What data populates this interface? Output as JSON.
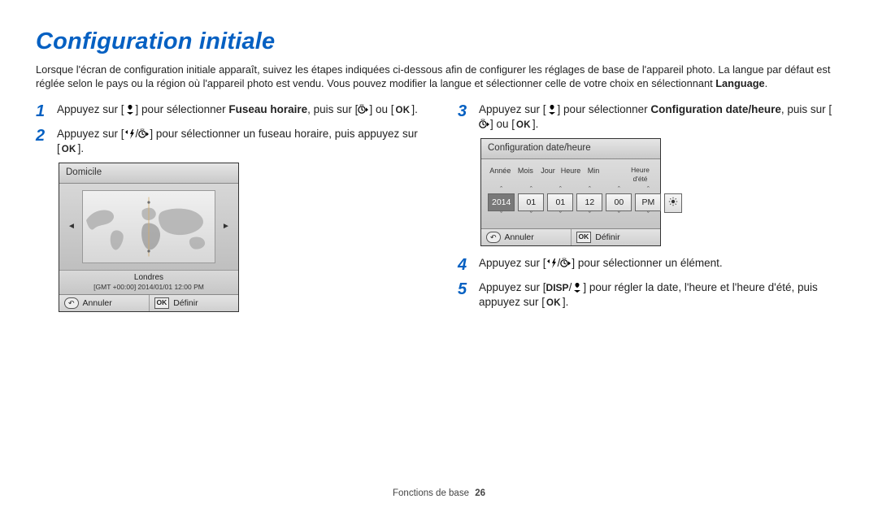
{
  "title": "Configuration initiale",
  "intro": {
    "part1": "Lorsque l'écran de configuration initiale apparaît, suivez les étapes indiquées ci-dessous afin de configurer les réglages de base de l'appareil photo. La langue par défaut est réglée selon le pays ou la région où l'appareil photo est vendu. Vous pouvez modifier la langue et sélectionner celle de votre choix en sélectionnant ",
    "lang_word": "Language",
    "part2": "."
  },
  "ok_label": "OK",
  "step1": {
    "num": "1",
    "pre": "Appuyez sur [",
    "mid1": "] pour sélectionner ",
    "bold": "Fuseau horaire",
    "mid2": ", puis sur [",
    "or": "] ou [",
    "end": "]."
  },
  "step2": {
    "num": "2",
    "pre": "Appuyez sur [",
    "slash": "/",
    "mid": "] pour sélectionner un fuseau horaire, puis appuyez sur [",
    "end": "]."
  },
  "step3": {
    "num": "3",
    "pre": "Appuyez sur [",
    "mid1": "] pour sélectionner ",
    "bold": "Configuration date/heure",
    "mid2": ", puis sur [",
    "or": "] ou [",
    "end": "]."
  },
  "step4": {
    "num": "4",
    "pre": "Appuyez sur [",
    "slash": "/",
    "mid": "] pour sélectionner un élément."
  },
  "step5": {
    "num": "5",
    "pre": "Appuyez sur [",
    "disp": "DISP",
    "slash": "/",
    "mid": "] pour régler la date, l'heure et l'heure d'été, puis appuyez sur [",
    "end": "]."
  },
  "screen_tz": {
    "title": "Domicile",
    "city": "Londres",
    "gmt": "[GMT +00:00] 2014/01/01 12:00 PM",
    "cancel": "Annuler",
    "set": "Définir"
  },
  "screen_dt": {
    "title": "Configuration date/heure",
    "labels": {
      "year": "Année",
      "month": "Mois",
      "day": "Jour",
      "hour": "Heure",
      "min": "Min",
      "dst": "Heure d'été"
    },
    "values": {
      "year": "2014",
      "month": "01",
      "day": "01",
      "hour": "12",
      "min": "00",
      "ampm": "PM",
      "dst": "☀"
    },
    "chev_up": "ˆ",
    "chev_down": "ˇ",
    "cancel": "Annuler",
    "set": "Définir"
  },
  "footer": {
    "section": "Fonctions de base",
    "page": "26"
  }
}
